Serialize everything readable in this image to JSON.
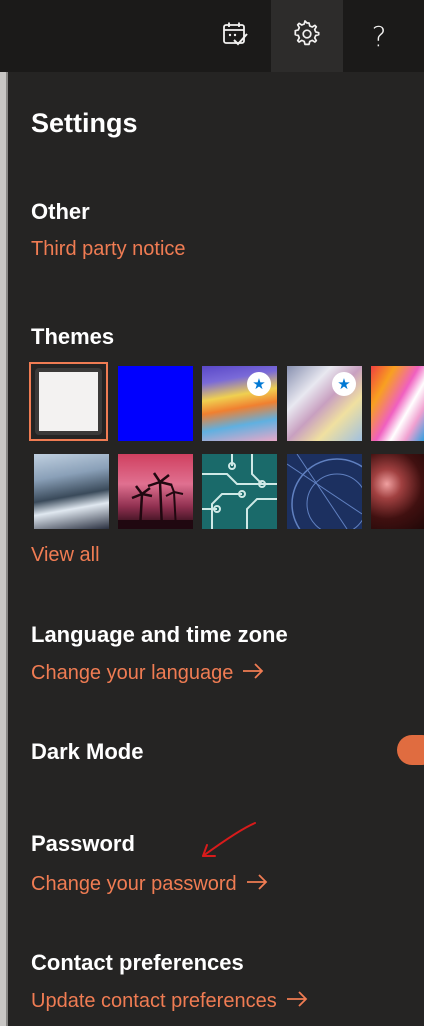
{
  "topbar": {
    "icons": [
      {
        "name": "calendar-check-icon"
      },
      {
        "name": "gear-icon"
      },
      {
        "name": "help-icon",
        "glyph": "?"
      }
    ]
  },
  "settings": {
    "title": "Settings",
    "other": {
      "heading": "Other",
      "link": "Third party notice"
    },
    "themes": {
      "heading": "Themes",
      "view_all": "View all",
      "selected_index": 0
    },
    "language": {
      "heading": "Language and time zone",
      "link": "Change your language"
    },
    "dark_mode": {
      "heading": "Dark Mode",
      "enabled": true
    },
    "password": {
      "heading": "Password",
      "link": "Change your password"
    },
    "contact": {
      "heading": "Contact preferences",
      "link": "Update contact preferences"
    }
  },
  "colors": {
    "accent": "#f07c53",
    "panel_bg": "#252423",
    "topbar_bg": "#1b1a19",
    "annotation": "#d81b1b"
  }
}
